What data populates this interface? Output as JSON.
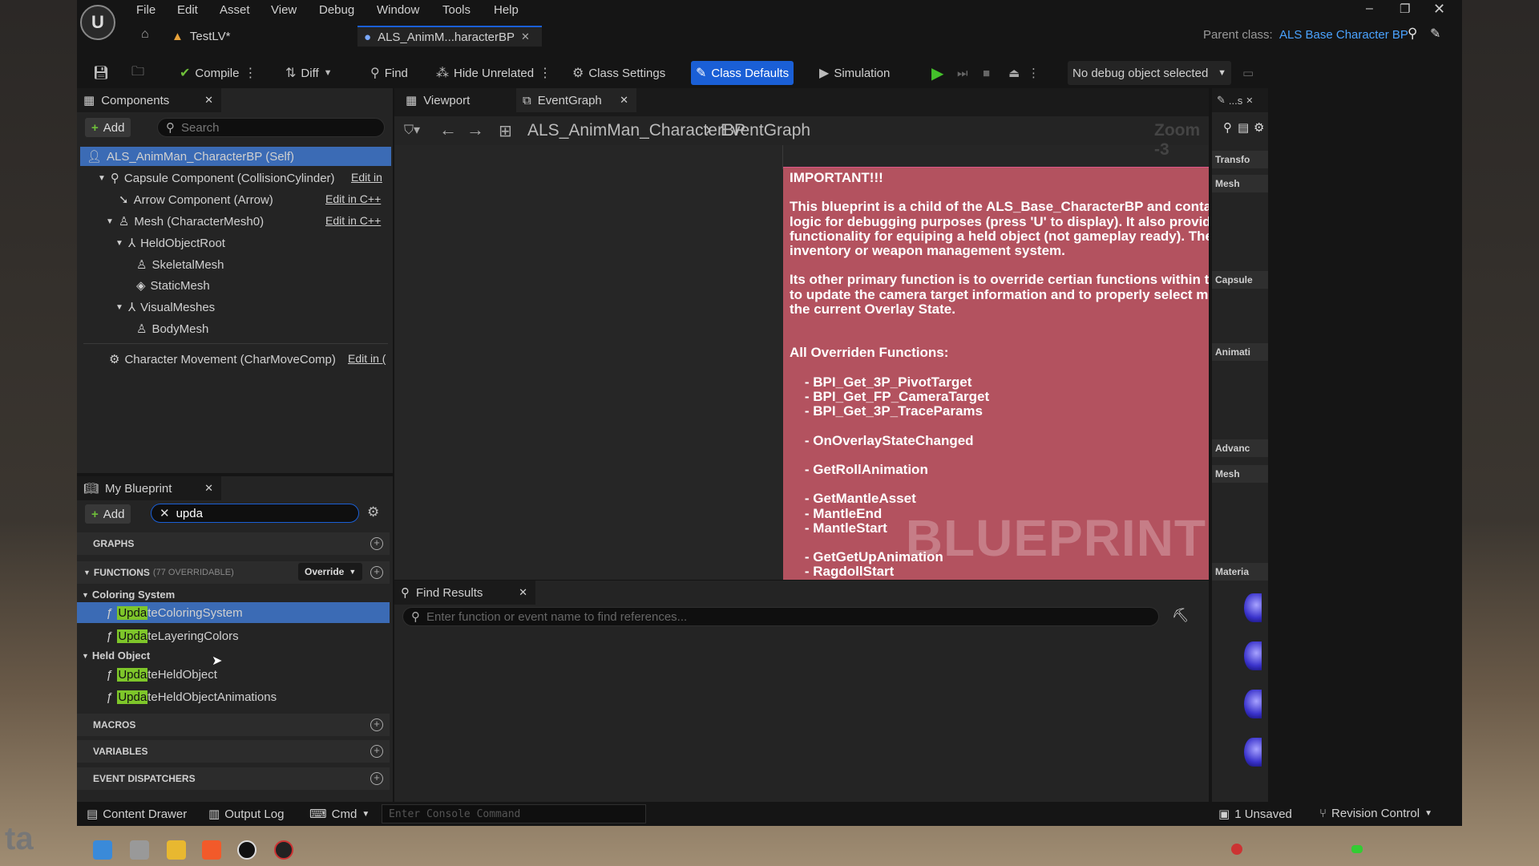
{
  "menu": [
    "File",
    "Edit",
    "Asset",
    "View",
    "Debug",
    "Window",
    "Tools",
    "Help"
  ],
  "tabs": {
    "level": "TestLV*",
    "asset": "ALS_AnimM...haracterBP"
  },
  "parent_class": {
    "label": "Parent class:",
    "value": "ALS Base Character BP"
  },
  "toolbar": {
    "compile": "Compile",
    "diff": "Diff",
    "find": "Find",
    "hide_unrelated": "Hide Unrelated",
    "class_settings": "Class Settings",
    "class_defaults": "Class Defaults",
    "simulation": "Simulation",
    "debug_object": "No debug object selected"
  },
  "components": {
    "title": "Components",
    "add": "Add",
    "search_placeholder": "Search",
    "items": [
      "ALS_AnimMan_CharacterBP (Self)",
      "Capsule Component (CollisionCylinder)",
      "Arrow Component (Arrow)",
      "Mesh (CharacterMesh0)",
      "HeldObjectRoot",
      "SkeletalMesh",
      "StaticMesh",
      "VisualMeshes",
      "BodyMesh",
      "Character Movement (CharMoveComp)"
    ],
    "edit_links": [
      "Edit in",
      "Edit in C++",
      "Edit in C++",
      "Edit in ("
    ]
  },
  "my_blueprint": {
    "title": "My Blueprint",
    "add": "Add",
    "search_value": "upda",
    "graphs": "GRAPHS",
    "functions": "FUNCTIONS",
    "functions_count": "(77 OVERRIDABLE)",
    "override": "Override",
    "cat_coloring": "Coloring System",
    "cat_held": "Held Object",
    "fn_match": "Upda",
    "fns": [
      "teColoringSystem",
      "teLayeringColors",
      "teHeldObject",
      "teHeldObjectAnimations"
    ],
    "macros": "MACROS",
    "variables": "VARIABLES",
    "event_dispatchers": "EVENT DISPATCHERS"
  },
  "graph_tabs": {
    "viewport": "Viewport",
    "eventgraph": "EventGraph"
  },
  "breadcrumb": {
    "root": "ALS_AnimMan_CharacterBP",
    "current": "EventGraph"
  },
  "zoom": "Zoom -3",
  "note": {
    "text": "IMPORTANT!!!\n\nThis blueprint is a child of the ALS_Base_CharacterBP and contains dynamic co\nlogic for debugging purposes (press 'U' to display). It also provides placeholder\nfunctionality for equiping a held object (not gameplay ready). There is currently\ninventory or weapon management system.\n\nIts other primary function is to override certian functions within the Base_Chara\nto update the camera target information and to properly select montages based\nthe current Overlay State.\n\n\nAll Overriden Functions:\n\n    - BPI_Get_3P_PivotTarget\n    - BPI_Get_FP_CameraTarget\n    - BPI_Get_3P_TraceParams\n\n    - OnOverlayStateChanged\n\n    - GetRollAnimation\n\n    - GetMantleAsset\n    - MantleEnd\n    - MantleStart\n\n    - GetGetUpAnimation\n    - RagdollStart",
    "watermark": "BLUEPRINT"
  },
  "find_results": {
    "title": "Find Results",
    "placeholder": "Enter function or event name to find references..."
  },
  "details": {
    "title": "...s",
    "sections": [
      "Transfo",
      "Mesh",
      "Capsule",
      "Animati",
      "Advanc",
      "Mesh",
      "Materia"
    ]
  },
  "status": {
    "content_drawer": "Content Drawer",
    "output_log": "Output Log",
    "cmd": "Cmd",
    "console_placeholder": "Enter Console Command",
    "unsaved": "1 Unsaved",
    "revision": "Revision Control"
  },
  "taskbar_left": "ta",
  "colors": {
    "accent": "#1a5fd6",
    "note": "#b3525f",
    "highlight": "#7ec62a",
    "link": "#4aa3ff"
  }
}
